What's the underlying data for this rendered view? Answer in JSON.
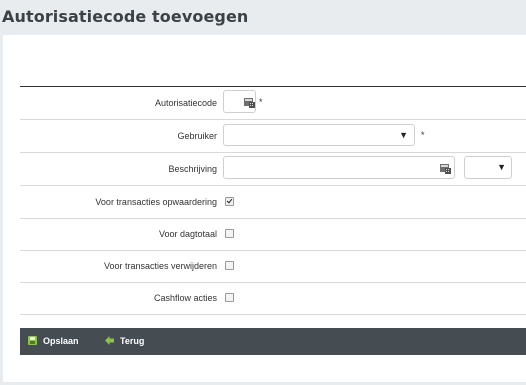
{
  "page": {
    "title": "Autorisatiecode toevoegen"
  },
  "form": {
    "autorisatiecode": {
      "label": "Autorisatiecode",
      "value": "",
      "required_mark": "*"
    },
    "gebruiker": {
      "label": "Gebruiker",
      "value": "",
      "required_mark": "*"
    },
    "beschrijving": {
      "label": "Beschrijving",
      "value": "",
      "lang_value": ""
    },
    "voor_transacties_opwaardering": {
      "label": "Voor transacties opwaardering",
      "checked": true
    },
    "voor_dagtotaal": {
      "label": "Voor dagtotaal",
      "checked": false
    },
    "voor_transacties_verwijderen": {
      "label": "Voor transacties verwijderen",
      "checked": false
    },
    "cashflow_acties": {
      "label": "Cashflow acties",
      "checked": false
    }
  },
  "toolbar": {
    "save_label": "Opslaan",
    "back_label": "Terug",
    "save_icon": "save-icon",
    "back_icon": "arrow-left-icon"
  },
  "colors": {
    "background": "#e9ecef",
    "toolbar": "#454d52",
    "save_icon": "#8bc34a",
    "back_icon": "#8bc34a"
  }
}
